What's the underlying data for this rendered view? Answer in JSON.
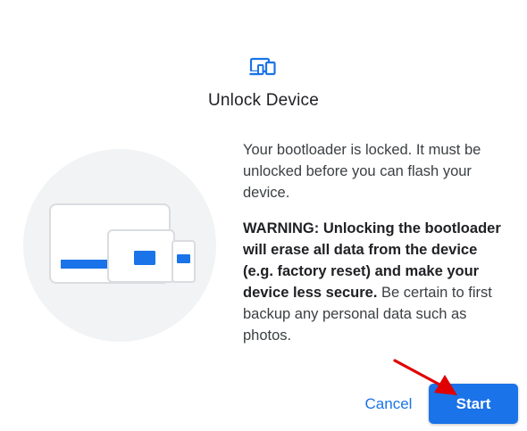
{
  "dialog": {
    "header_icon": "devices-icon",
    "title": "Unlock Device",
    "illustration": "devices-illustration",
    "body_lead": "Your bootloader is locked. It must be unlocked before you can flash your device.",
    "warning_bold": "WARNING: Unlocking the bootloader will erase all data from the device (e.g. factory reset) and make your device less secure.",
    "warning_rest": " Be certain to first backup any personal data such as photos."
  },
  "actions": {
    "cancel_label": "Cancel",
    "start_label": "Start"
  },
  "annotation": {
    "icon": "red-arrow-icon",
    "color": "#e00000"
  },
  "colors": {
    "accent": "#1a73e8",
    "illustration_bg": "#f1f3f4",
    "device_outline": "#dadce0"
  }
}
